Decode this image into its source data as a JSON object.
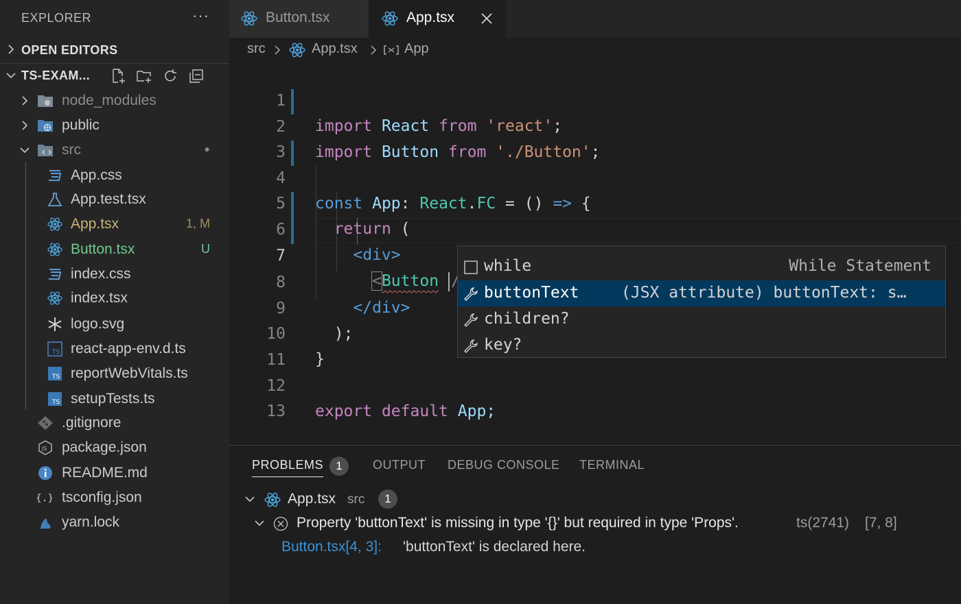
{
  "sidebar": {
    "header": "EXPLORER",
    "more": "···",
    "sections": {
      "open_editors": "OPEN EDITORS",
      "project": "TS-EXAM..."
    },
    "tree": [
      {
        "name": "node_modules",
        "kind": "folder",
        "icon": "folder-node-icon",
        "badge": ""
      },
      {
        "name": "public",
        "kind": "folder",
        "icon": "folder-public-icon",
        "badge": ""
      },
      {
        "name": "src",
        "kind": "folder-open",
        "icon": "folder-src-icon",
        "badge": "●"
      },
      {
        "name": "App.css",
        "kind": "file",
        "icon": "css-icon",
        "badge": ""
      },
      {
        "name": "App.test.tsx",
        "kind": "file",
        "icon": "test-flask-icon",
        "badge": ""
      },
      {
        "name": "App.tsx",
        "kind": "file",
        "icon": "react-icon",
        "badge": "1, M"
      },
      {
        "name": "Button.tsx",
        "kind": "file",
        "icon": "react-icon",
        "badge": "U"
      },
      {
        "name": "index.css",
        "kind": "file",
        "icon": "css-icon",
        "badge": ""
      },
      {
        "name": "index.tsx",
        "kind": "file",
        "icon": "react-icon",
        "badge": ""
      },
      {
        "name": "logo.svg",
        "kind": "file",
        "icon": "svg-asterisk-icon",
        "badge": ""
      },
      {
        "name": "react-app-env.d.ts",
        "kind": "file",
        "icon": "ts-def-icon",
        "badge": ""
      },
      {
        "name": "reportWebVitals.ts",
        "kind": "file",
        "icon": "ts-icon",
        "badge": ""
      },
      {
        "name": "setupTests.ts",
        "kind": "file",
        "icon": "ts-icon",
        "badge": ""
      },
      {
        "name": ".gitignore",
        "kind": "file",
        "icon": "git-icon",
        "badge": ""
      },
      {
        "name": "package.json",
        "kind": "file",
        "icon": "js-icon",
        "badge": ""
      },
      {
        "name": "README.md",
        "kind": "file",
        "icon": "info-icon",
        "badge": ""
      },
      {
        "name": "tsconfig.json",
        "kind": "file",
        "icon": "json-braces-icon",
        "badge": ""
      },
      {
        "name": "yarn.lock",
        "kind": "file",
        "icon": "yarn-icon",
        "badge": ""
      }
    ]
  },
  "tabs": [
    {
      "label": "Button.tsx",
      "active": false
    },
    {
      "label": "App.tsx",
      "active": true
    }
  ],
  "breadcrumb": {
    "part1": "src",
    "part2": "App.tsx",
    "part3": "App"
  },
  "editor": {
    "line_numbers": [
      "1",
      "2",
      "3",
      "4",
      "5",
      "6",
      "7",
      "8",
      "9",
      "10",
      "11",
      "12",
      "13"
    ],
    "active_line": "7",
    "tokens": {
      "import": "import",
      "react_ident": "React",
      "from": "from",
      "react_str": "'react'",
      "semi": ";",
      "button_ident": "Button",
      "button_str": "'./Button'",
      "const": "const",
      "app": "App",
      "colon": ":",
      "react_ns": "React",
      "dot": ".",
      "fc": "FC",
      "eq": "=",
      "parens": "()",
      "arrow": "=>",
      "brace_open": "{",
      "return": "return",
      "paren_open": "(",
      "div_open": "<div>",
      "lt": "<",
      "button_tag": "Button",
      "slash": "/",
      "gt": ">",
      "div_close": "</div>",
      "paren_close_semi": ");",
      "brace_close": "}",
      "export": "export",
      "default": "default",
      "app_end": "App;"
    }
  },
  "suggestions": [
    {
      "label": "while",
      "detail": "While Statement",
      "icon": "snippet-icon",
      "selected": false
    },
    {
      "label": "buttonText",
      "detail": "(JSX attribute) buttonText: s…",
      "icon": "wrench-icon",
      "selected": true
    },
    {
      "label": "children?",
      "detail": "",
      "icon": "wrench-icon",
      "selected": false
    },
    {
      "label": "key?",
      "detail": "",
      "icon": "wrench-icon",
      "selected": false
    }
  ],
  "panel": {
    "tabs": {
      "problems": "PROBLEMS",
      "output": "OUTPUT",
      "debug": "DEBUG CONSOLE",
      "terminal": "TERMINAL"
    },
    "problem_count": "1",
    "file": {
      "name": "App.tsx",
      "folder": "src",
      "count": "1"
    },
    "error": {
      "message": "Property 'buttonText' is missing in type '{}' but required in type 'Props'.",
      "code": "ts(2741)",
      "position": "[7, 8]"
    },
    "related": {
      "location": "Button.tsx[4, 3]:",
      "message": "'buttonText' is declared here."
    }
  },
  "colors": {
    "sidebar_bg": "#252526",
    "editor_bg": "#1e1e1e",
    "selection": "#04395e",
    "keyword": "#569cd6",
    "type": "#4ec9b0",
    "string": "#ce9178",
    "react_icon": "#4fa6e0"
  }
}
